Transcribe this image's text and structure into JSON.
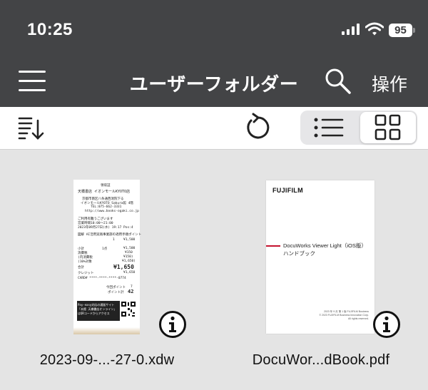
{
  "status_bar": {
    "time": "10:25",
    "battery": "95"
  },
  "nav_bar": {
    "title": "ユーザーフォルダー",
    "operations_label": "操作"
  },
  "files": [
    {
      "name": "2023-09-...-27-0.xdw",
      "receipt": {
        "header": "領収証",
        "store": "天橋書店 イオンモールKYOTO店",
        "address": "京都市南区八条通西洞院下る",
        "address2": "イオンモールKYOTO Sakura館 4階",
        "tel": "TEL:075-662-3331",
        "url": "http://www.books-ogaki.co.jp",
        "thanks": "ご利用有難うございます",
        "hours": "営業時間10:00〜21:00",
        "date": "2023年09月27日(水) 19:17 Pos:4",
        "item1": "図解 AI活用実践事業部の適用手順ポイント",
        "item1_price": "¥1,500",
        "item1_qty": "1",
        "subtotal_label": "小計",
        "subtotal_qty": "1点",
        "subtotal": "¥1,500",
        "tax_label": "消費税",
        "tax": "¥150",
        "tax10_label": "(内消費税",
        "tax10": "¥150)",
        "target_label": "(10%対象",
        "target": "¥1,650)",
        "total_label": "合計",
        "total": "¥1,650",
        "credit_label": "クレジット",
        "credit": "¥1,650",
        "card": "CARD# ****-****-****-0774",
        "points_label": "今回ポイント",
        "points": "7",
        "points_total_label": "ポイント計",
        "points_total": "42",
        "footer": "Pay-easy対応の通販サイト「本館 天橋書店オンライン」はQRコードからアクセス"
      }
    },
    {
      "name": "DocuWor...dBook.pdf",
      "pdf": {
        "brand": "FUJIFILM",
        "title_line1": "DocuWorks Viewer Light（iOS版）",
        "title_line2": "ハンドブック",
        "footer_line1": "2023 年 9 月 第 1 版 FUJIFILM Business",
        "footer_line2": "© 2023 FUJIFILM Business Innovation Corp. All rights reserved."
      }
    }
  ],
  "icons": {
    "menu": "hamburger-menu-icon",
    "search": "search-icon",
    "sort": "sort-icon",
    "refresh": "refresh-icon",
    "list_view": "list-view-icon",
    "grid_view": "grid-view-icon",
    "info": "info-icon"
  },
  "colors": {
    "nav_background": "#434446",
    "content_background": "#e4e4e4",
    "accent_bar": "#c4122f"
  }
}
